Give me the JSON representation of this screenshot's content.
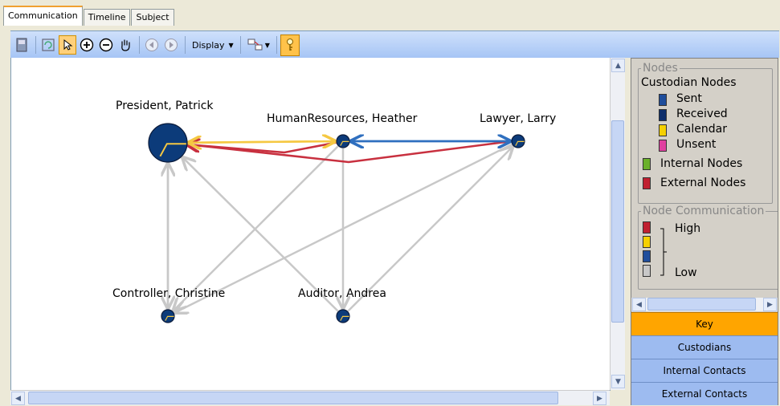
{
  "tabs": [
    {
      "label": "Communication",
      "active": true
    },
    {
      "label": "Timeline",
      "active": false
    },
    {
      "label": "Subject",
      "active": false
    }
  ],
  "toolbar": {
    "icons": [
      "save-icon",
      "refresh-icon",
      "pointer-icon",
      "zoom-in-icon",
      "zoom-out-icon",
      "pan-hand-icon",
      "back-icon",
      "forward-icon",
      "layout-icon",
      "key-icon"
    ],
    "display_label": "Display"
  },
  "graph": {
    "nodes": [
      {
        "id": "president",
        "label": "President, Patrick"
      },
      {
        "id": "hr",
        "label": "HumanResources, Heather"
      },
      {
        "id": "lawyer",
        "label": "Lawyer, Larry"
      },
      {
        "id": "controller",
        "label": "Controller, Christine"
      },
      {
        "id": "auditor",
        "label": "Auditor, Andrea"
      }
    ],
    "edges": [
      {
        "from": "hr",
        "to": "president",
        "level": "calendar",
        "color": "#f5c842"
      },
      {
        "from": "president",
        "to": "hr",
        "level": "calendar",
        "color": "#f5c842"
      },
      {
        "from": "lawyer",
        "to": "hr",
        "level": "sent",
        "color": "#2f6fbf"
      },
      {
        "from": "hr",
        "to": "lawyer",
        "level": "sent",
        "color": "#2f6fbf"
      },
      {
        "from": "lawyer",
        "to": "president",
        "level": "high",
        "color": "#c8303f"
      },
      {
        "from": "hr",
        "to": "president",
        "level": "high",
        "color": "#c8303f"
      },
      {
        "from": "controller",
        "to": "president",
        "level": "low",
        "color": "#c8c8c8"
      },
      {
        "from": "president",
        "to": "controller",
        "level": "low",
        "color": "#c8c8c8"
      },
      {
        "from": "auditor",
        "to": "president",
        "level": "low",
        "color": "#c8c8c8"
      },
      {
        "from": "hr",
        "to": "controller",
        "level": "low",
        "color": "#c8c8c8"
      },
      {
        "from": "lawyer",
        "to": "controller",
        "level": "low",
        "color": "#c8c8c8"
      },
      {
        "from": "hr",
        "to": "auditor",
        "level": "low",
        "color": "#c8c8c8"
      },
      {
        "from": "auditor",
        "to": "lawyer",
        "level": "low",
        "color": "#c8c8c8"
      }
    ]
  },
  "legend": {
    "nodes_title": "Nodes",
    "custodian_title": "Custodian Nodes",
    "custodian_items": [
      {
        "label": "Sent",
        "color": "#1f4e9c"
      },
      {
        "label": "Received",
        "color": "#0d2e6b"
      },
      {
        "label": "Calendar",
        "color": "#f5d000"
      },
      {
        "label": "Unsent",
        "color": "#e040a0"
      }
    ],
    "internal_label": "Internal Nodes",
    "internal_color": "#6ab02a",
    "external_label": "External Nodes",
    "external_color": "#c02030",
    "comm_title": "Node Communication",
    "comm_colors": [
      "#c02030",
      "#f5d000",
      "#1f4e9c",
      "#c8c8c8"
    ],
    "high_label": "High",
    "low_label": "Low"
  },
  "panel_buttons": [
    {
      "label": "Key",
      "active": true
    },
    {
      "label": "Custodians",
      "active": false
    },
    {
      "label": "Internal Contacts",
      "active": false
    },
    {
      "label": "External Contacts",
      "active": false
    }
  ]
}
